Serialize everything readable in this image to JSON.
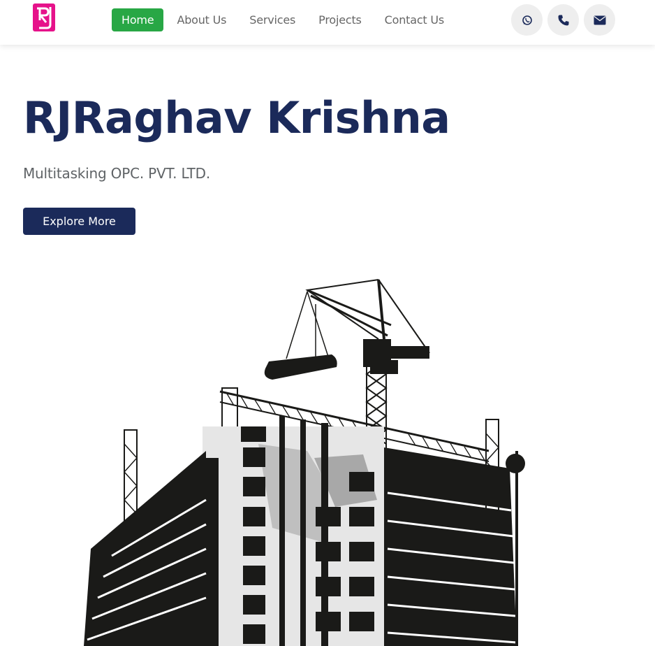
{
  "brand": {
    "logo_icon": "rj-monogram-logo",
    "logo_color": "#e6128a"
  },
  "nav": {
    "items": [
      {
        "label": "Home",
        "active": true
      },
      {
        "label": "About Us",
        "active": false
      },
      {
        "label": "Services",
        "active": false
      },
      {
        "label": "Projects",
        "active": false
      },
      {
        "label": "Contact Us",
        "active": false
      }
    ],
    "active_color": "#28a745"
  },
  "contact_icons": [
    "whatsapp-icon",
    "phone-icon",
    "envelope-icon"
  ],
  "hero": {
    "title": "RJRaghav Krishna",
    "subtitle": "Multitasking OPC. PVT. LTD.",
    "cta_label": "Explore More",
    "title_color": "#1b2a5a"
  },
  "illustration": {
    "icon": "building-under-construction-with-tower-crane"
  }
}
